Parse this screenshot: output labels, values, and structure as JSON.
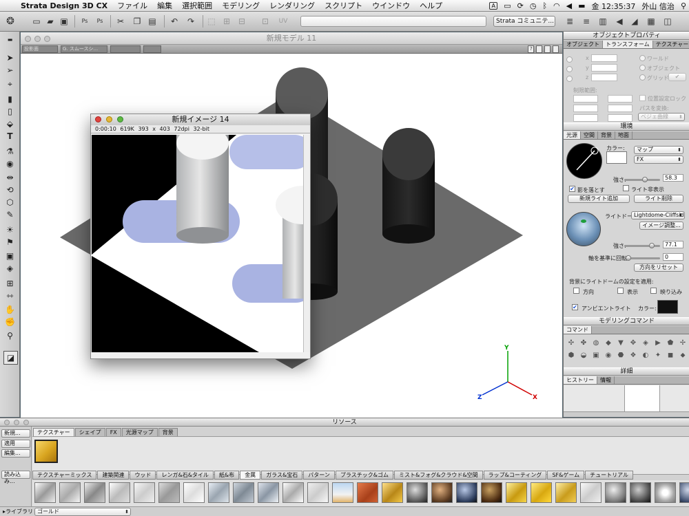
{
  "menubar": {
    "app_name": "Strata Design 3D CX",
    "menus": [
      "ファイル",
      "編集",
      "選択範囲",
      "モデリング",
      "レンダリング",
      "スクリプト",
      "ウインドウ",
      "ヘルプ"
    ],
    "clock": "金 12:35:37",
    "user": "外山 信治"
  },
  "toolbar": {
    "community_menu": "Strata コミュニテ..."
  },
  "model_window": {
    "title": "新規モデル 11",
    "view_select": "投影面",
    "render_select": "G. スムースシ..."
  },
  "image_window": {
    "title": "新規イメージ 14",
    "info": {
      "time": "0:00:10",
      "size": "619K",
      "dimensions": "393 x 403",
      "dpi": "72dpi",
      "depth": "32-bit"
    }
  },
  "axis": {
    "y": "Y",
    "z": "Z",
    "x": "X"
  },
  "object_properties": {
    "title": "オブジェクトプロパティ",
    "tabs": [
      "オブジェクト",
      "トランスフォーム",
      "テクスチャー"
    ],
    "coord_labels": [
      "x",
      "y",
      "z"
    ],
    "radio_world": "ワールド",
    "radio_object": "オブジェクト",
    "radio_grid": "グリッド",
    "limit_label": "制限範囲:",
    "lock_label": "位置設定ロック",
    "path_label": "パスを変換:",
    "path_select": "ベジェ曲線"
  },
  "environment": {
    "title": "環境",
    "tabs": [
      "光源",
      "空間",
      "背景",
      "地面"
    ],
    "color_label": "カラー:",
    "map_select": "マップ",
    "fx_select": "FX",
    "intensity_label": "強さ:",
    "intensity_value": "58.3",
    "intensity_fraction": 0.58,
    "shadow_label": "影を落とす",
    "hide_light_label": "ライト非表示",
    "add_light_button": "新規ライト追加",
    "delete_light_button": "ライト削除",
    "lightdome_label": "ライトドーム:",
    "lightdome_select": "Lightdome-Cliffside",
    "image_adjust_button": "イメージ調整...",
    "dome_intensity_value": "77.1",
    "dome_intensity_fraction": 0.77,
    "rotate_label": "軸を基準に回転:",
    "rotate_value": "0",
    "reset_button": "方向をリセット",
    "apply_label": "背景にライトドームの設定を適用:",
    "direction_label": "方向",
    "display_label": "表示",
    "reflection_label": "映り込み",
    "ambient_label": "アンビエントライト",
    "ambient_color_label": "カラー:"
  },
  "modeling": {
    "title": "モデリングコマンド",
    "tab": "コマンド"
  },
  "detail": {
    "title": "詳細",
    "tabs": [
      "ヒストリー",
      "情報"
    ]
  },
  "resources": {
    "title": "リソース",
    "new_button": "新規...",
    "apply_button": "適用",
    "edit_button": "編集...",
    "load_button": "読み込み...",
    "library_label": "ライブラリ",
    "gold_label": "ゴールド",
    "tabs": [
      "テクスチャー",
      "シェイプ",
      "FX",
      "光源マップ",
      "背景"
    ],
    "categories": [
      "テクスチャーミックス",
      "建築関連",
      "ウッド",
      "レンガ&石&タイル",
      "紙&布",
      "金属",
      "ガラス&宝石",
      "パターン",
      "プラスチック&ゴム",
      "ミスト&フォグ&クラウド&空間",
      "ラップ&コーティング",
      "SF&ゲーム",
      "チュートリアル"
    ],
    "active_category": "金属"
  },
  "colors": {
    "selection_blue": "#1a4fd0",
    "ambient_swatch": "#111111",
    "gold": "#d9a520"
  }
}
